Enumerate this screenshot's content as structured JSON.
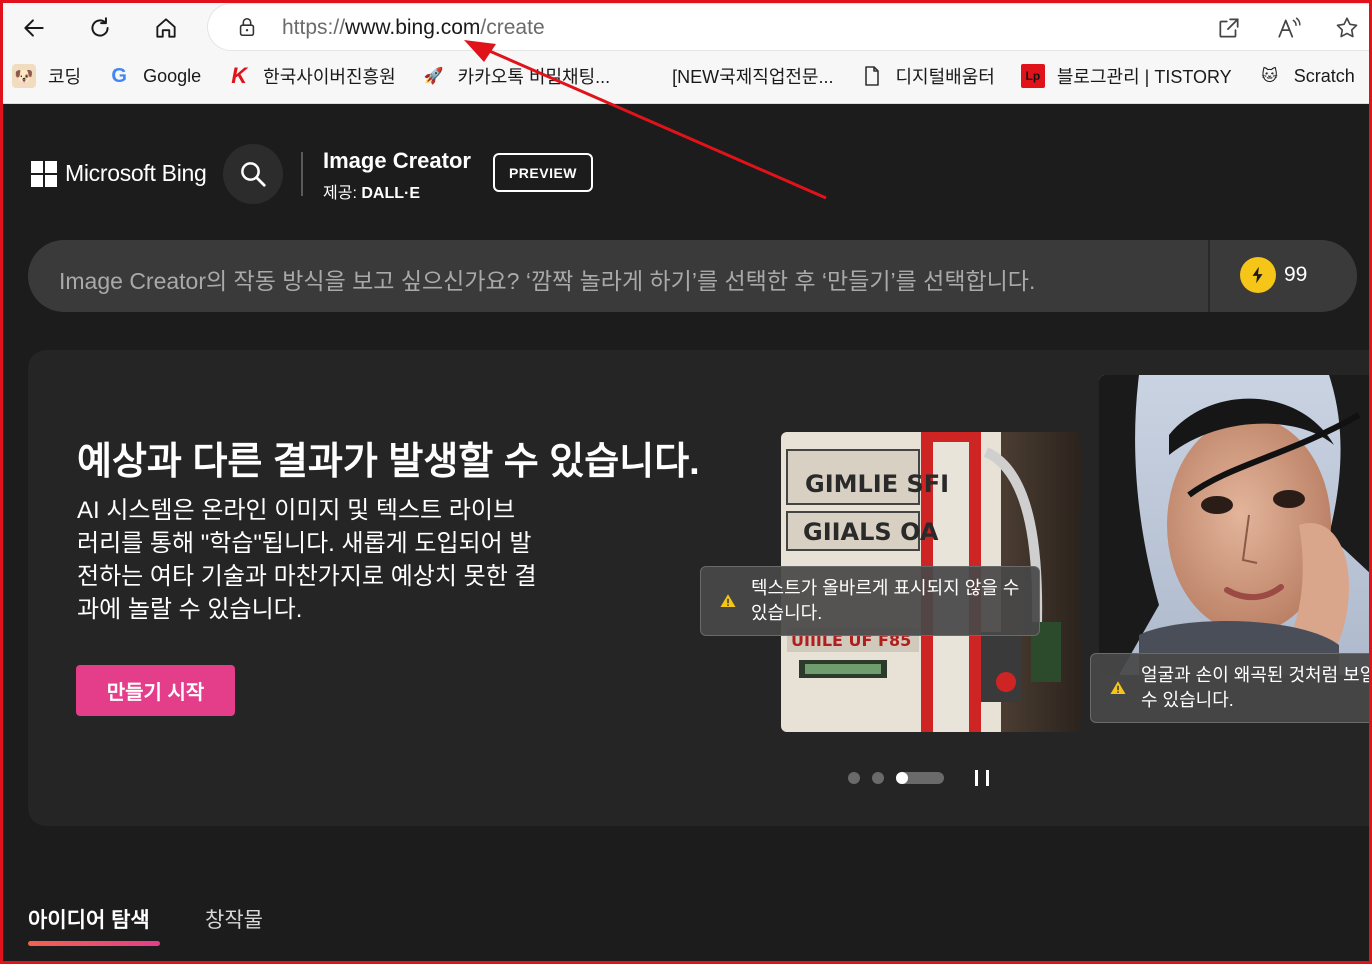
{
  "browser": {
    "url_prefix": "https://",
    "url_domain": "www.bing.com",
    "url_path": "/create",
    "bookmarks": [
      {
        "label": "코딩"
      },
      {
        "label": "Google"
      },
      {
        "label": "한국사이버진흥원"
      },
      {
        "label": "카카오톡 비밀채팅..."
      },
      {
        "label": "[NEW국제직업전문..."
      },
      {
        "label": "디지털배움터"
      },
      {
        "label": "블로그관리 | TISTORY"
      },
      {
        "label": "Scratch"
      }
    ]
  },
  "header": {
    "brand": "Microsoft Bing",
    "product_title": "Image Creator",
    "provider_label": "제공:",
    "provider_name": "DALL·E",
    "preview_badge": "PREVIEW"
  },
  "prompt": {
    "placeholder": "Image Creator의 작동 방식을 보고 싶으신가요? ‘깜짝 놀라게 하기’를 선택한 후 ‘만들기’를 선택합니다.",
    "boosts": "99"
  },
  "hero": {
    "title": "예상과 다른 결과가 발생할 수 있습니다.",
    "description": "AI 시스템은 온라인 이미지 및 텍스트 라이브러리를 통해 \"학습\"됩니다. 새롭게 도입되어 발전하는 여타 기술과 마찬가지로 예상치 못한 결과에 놀랄 수 있습니다.",
    "cta": "만들기 시작",
    "warning_text": "텍스트가 올바르게 표시되지 않을 수 있습니다.",
    "warning_face": "얼굴과 손이 왜곡된 것처럼 보일 수 있습니다.",
    "gas_sign_line1": "GIMLIE SFI",
    "gas_sign_line2": "GIIALS OA",
    "gas_sign_line3": "UIIILE UF F85"
  },
  "tabs": {
    "explore": "아이디어 탐색",
    "creations": "창작물"
  },
  "colors": {
    "accent_pink": "#e43d8a",
    "background": "#1d1c1c",
    "annotation_red": "#e0131a"
  }
}
